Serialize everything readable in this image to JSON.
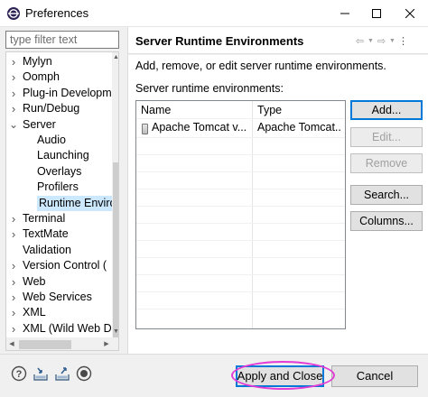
{
  "window": {
    "title": "Preferences",
    "icons": {
      "app": "eclipse-icon",
      "minimize": "minimize-icon",
      "maximize": "maximize-icon",
      "close": "close-icon"
    }
  },
  "filter": {
    "placeholder": "type filter text",
    "value": ""
  },
  "tree": {
    "items": [
      {
        "label": "Mylyn",
        "expandable": true,
        "expanded": false,
        "selected": false
      },
      {
        "label": "Oomph",
        "expandable": true,
        "expanded": false,
        "selected": false
      },
      {
        "label": "Plug-in Developm",
        "expandable": true,
        "expanded": false,
        "selected": false
      },
      {
        "label": "Run/Debug",
        "expandable": true,
        "expanded": false,
        "selected": false
      },
      {
        "label": "Server",
        "expandable": true,
        "expanded": true,
        "selected": false
      },
      {
        "label": "Audio",
        "expandable": false,
        "expanded": false,
        "selected": false
      },
      {
        "label": "Launching",
        "expandable": false,
        "expanded": false,
        "selected": false
      },
      {
        "label": "Overlays",
        "expandable": false,
        "expanded": false,
        "selected": false
      },
      {
        "label": "Profilers",
        "expandable": false,
        "expanded": false,
        "selected": false
      },
      {
        "label": "Runtime Enviro",
        "expandable": false,
        "expanded": false,
        "selected": true
      },
      {
        "label": "Terminal",
        "expandable": true,
        "expanded": false,
        "selected": false
      },
      {
        "label": "TextMate",
        "expandable": true,
        "expanded": false,
        "selected": false
      },
      {
        "label": "Validation",
        "expandable": false,
        "expanded": false,
        "selected": false
      },
      {
        "label": "Version Control (",
        "expandable": true,
        "expanded": false,
        "selected": false
      },
      {
        "label": "Web",
        "expandable": true,
        "expanded": false,
        "selected": false
      },
      {
        "label": "Web Services",
        "expandable": true,
        "expanded": false,
        "selected": false
      },
      {
        "label": "XML",
        "expandable": true,
        "expanded": false,
        "selected": false
      },
      {
        "label": "XML (Wild Web D",
        "expandable": true,
        "expanded": false,
        "selected": false
      }
    ]
  },
  "page": {
    "title": "Server Runtime Environments",
    "description": "Add, remove, or edit server runtime environments.",
    "list_label": "Server runtime environments:",
    "nav_icons": [
      "back-icon",
      "back-menu-icon",
      "forward-icon",
      "forward-menu-icon",
      "view-menu-icon"
    ]
  },
  "table": {
    "columns": [
      "Name",
      "Type"
    ],
    "rows": [
      {
        "name": "Apache Tomcat v...",
        "type": "Apache Tomcat...",
        "icon": "server-icon"
      }
    ]
  },
  "buttons": {
    "add": "Add...",
    "edit": "Edit...",
    "remove": "Remove",
    "search": "Search...",
    "columns": "Columns...",
    "apply_and_close": "Apply and Close",
    "cancel": "Cancel"
  },
  "bottom_icons": [
    "help-icon",
    "import-icon",
    "export-icon",
    "record-icon"
  ],
  "colors": {
    "selection": "#cce8ff",
    "accent": "#0078d7",
    "annotation": "#e23bd6"
  }
}
